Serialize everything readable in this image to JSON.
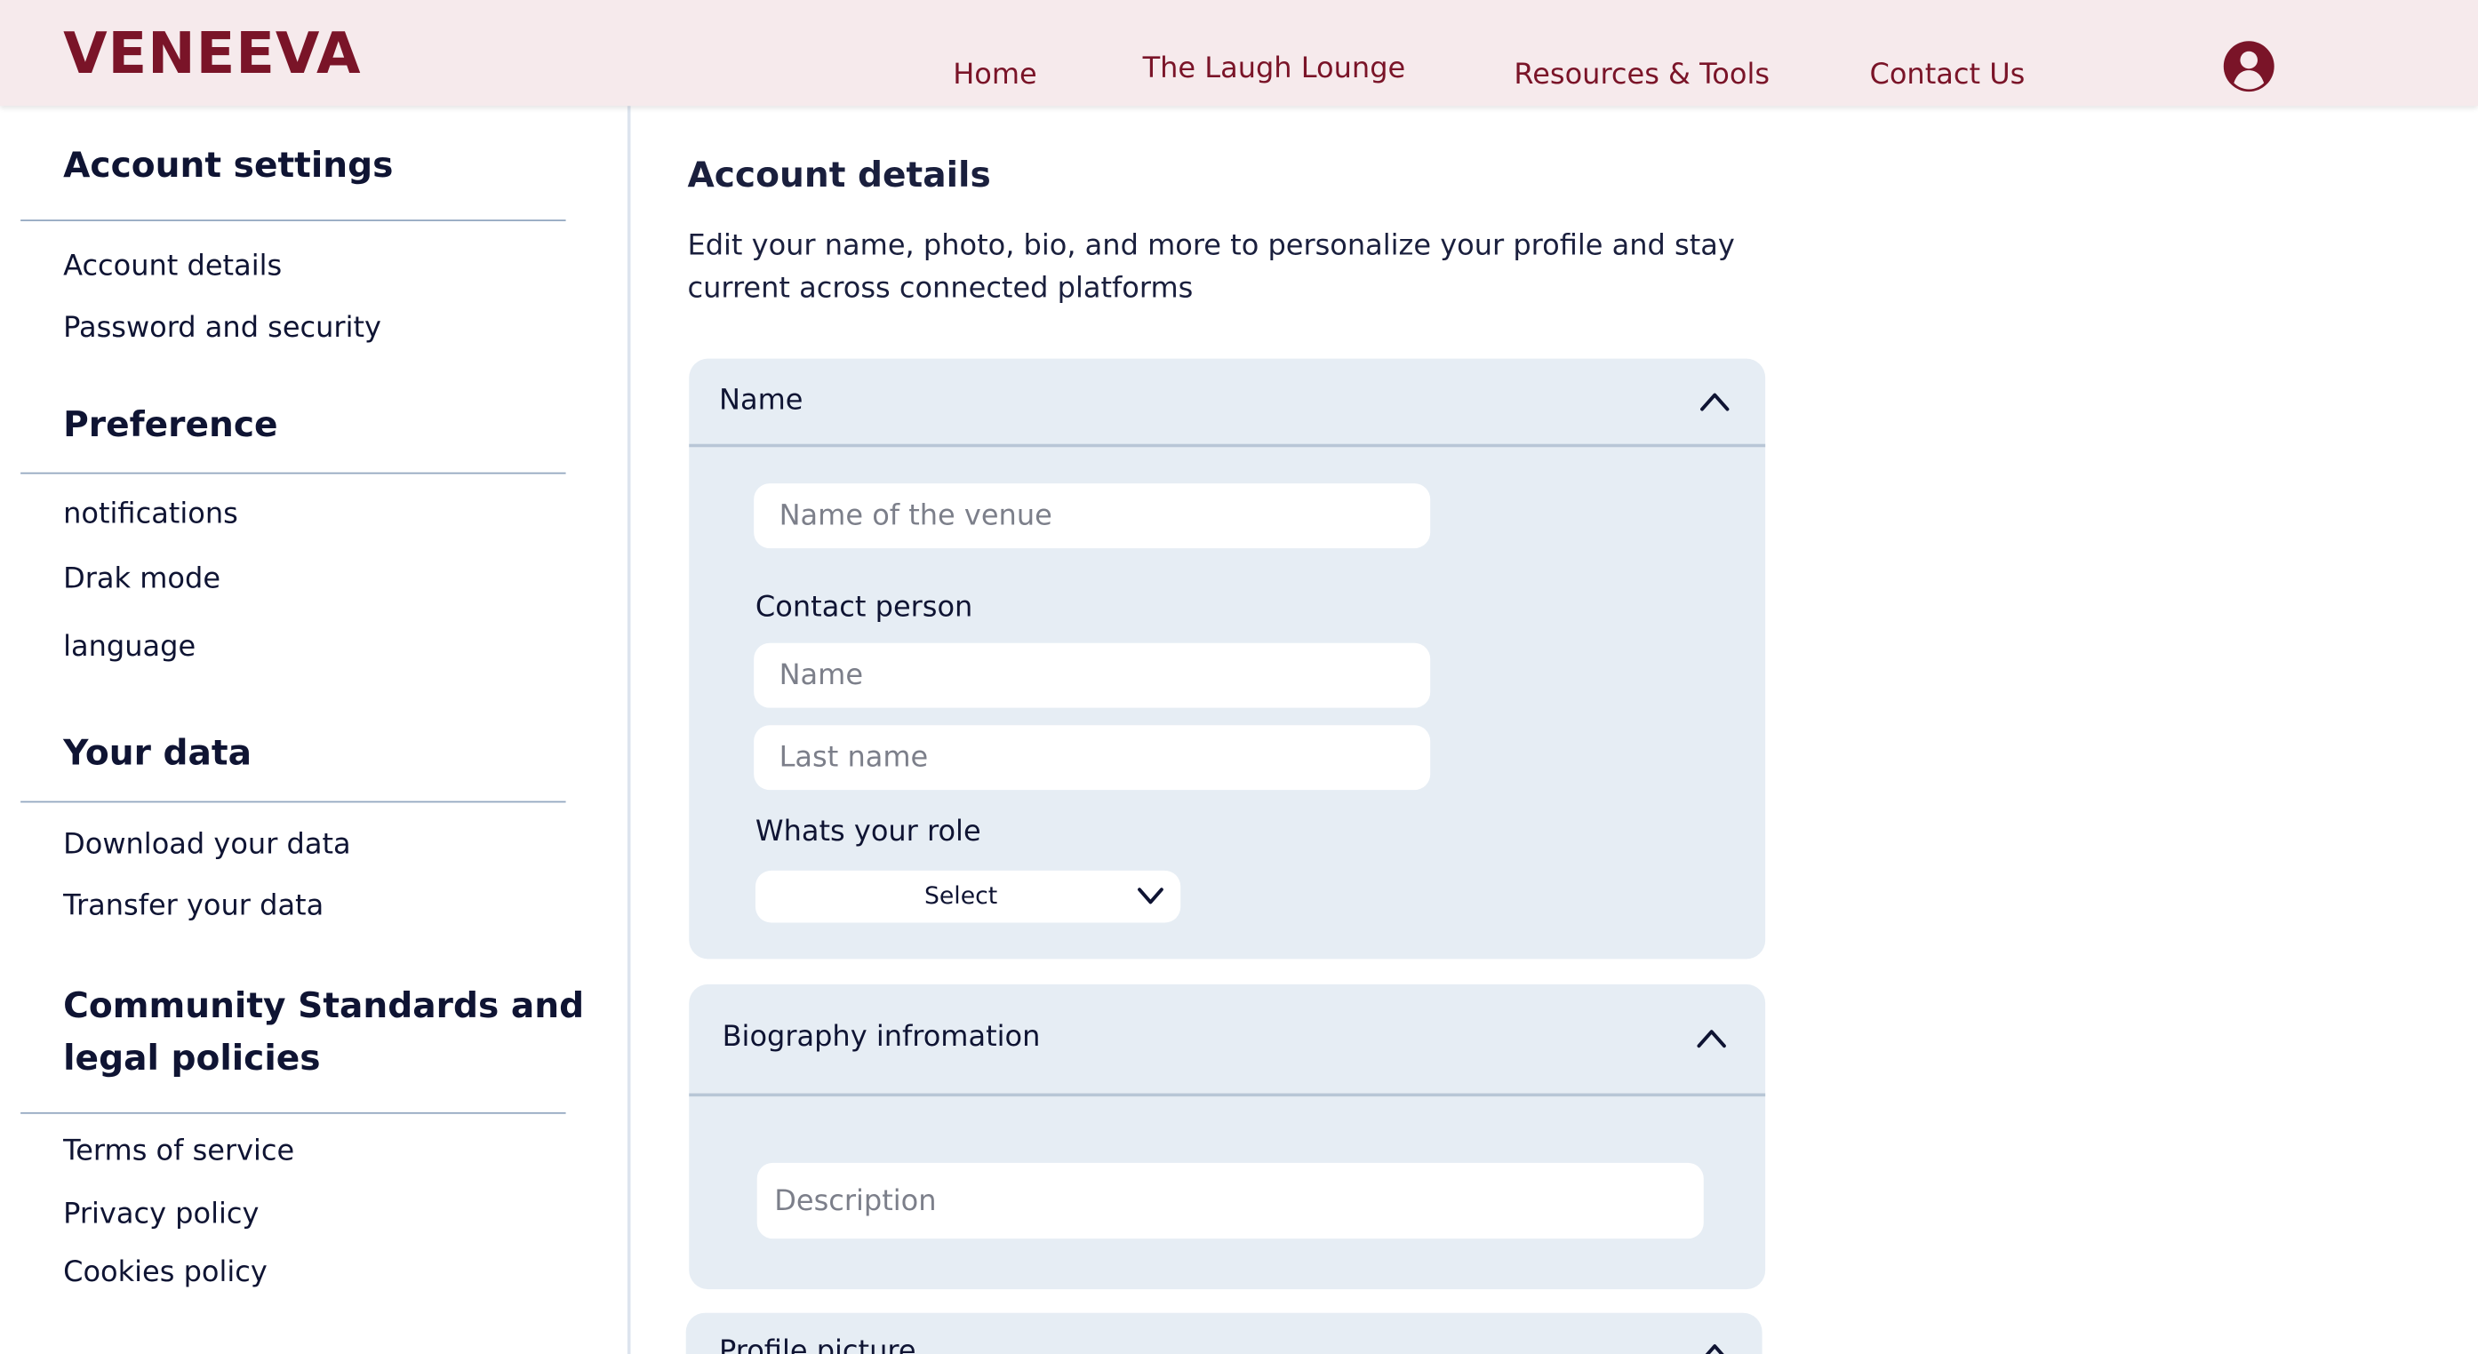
{
  "brand": {
    "logo": "VENEEVA",
    "color": "#7a1428"
  },
  "nav": {
    "links": [
      "Home",
      "The Laugh Lounge",
      "Resources & Tools",
      "Contact Us"
    ],
    "profile_icon": "user-circle-icon"
  },
  "sidebar": {
    "sections": [
      {
        "heading": "Account settings",
        "items": [
          "Account details",
          "Password and security"
        ]
      },
      {
        "heading": "Preference",
        "items": [
          "notifications",
          "Drak mode",
          "language"
        ]
      },
      {
        "heading": "Your data",
        "items": [
          "Download your data",
          "Transfer your data"
        ]
      },
      {
        "heading": "Community Standards and legal policies",
        "items": [
          "Terms of service",
          "Privacy policy",
          "Cookies policy"
        ]
      }
    ]
  },
  "main": {
    "title": "Account details",
    "description": "Edit your name, photo, bio, and more to personalize your profile and stay current across connected platforms",
    "name_card": {
      "title": "Name",
      "venue_placeholder": "Name of the venue",
      "contact_label": "Contact person",
      "first_placeholder": "Name",
      "last_placeholder": "Last name",
      "role_label": "Whats your role",
      "role_select": "Select"
    },
    "bio_card": {
      "title": "Biography infromation",
      "description_placeholder": "Description"
    },
    "profile_card": {
      "title": "Profile picture"
    }
  }
}
